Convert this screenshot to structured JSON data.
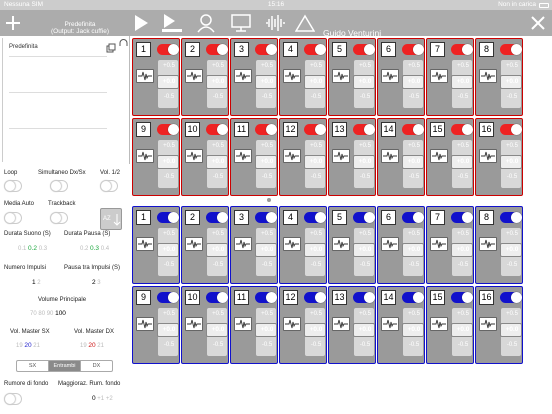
{
  "status": {
    "carrier": "Nessuna SIM",
    "time": "15:16",
    "battery": "Non in carica"
  },
  "toolbar": {
    "preset_title": "Predefinita",
    "output": "(Output: Jack cuffie)",
    "user": "Guido Venturini"
  },
  "left": {
    "preset_name": "Predefinita",
    "loop": "Loop",
    "simultaneo": "Simultaneo Dx/Sx",
    "vol_half": "Vol. 1/2",
    "media_auto": "Media Auto",
    "trackback": "Trackback",
    "az": "AZ",
    "durata_suono": "Durata Suono (S)",
    "durata_pausa": "Durata Pausa (S)",
    "ds_vals": [
      "0.1",
      "0.2",
      "0.3"
    ],
    "dp_vals": [
      "0.2",
      "0.3",
      "0.4"
    ],
    "numero_impulsi": "Numero Impulsi",
    "pausa_impulsi": "Pausa tra Impulsi (S)",
    "ni_vals": [
      "1",
      "2"
    ],
    "pi_vals": [
      "2",
      "3"
    ],
    "volume_principale": "Volume Principale",
    "vp_vals": [
      "70",
      "80",
      "90",
      "100"
    ],
    "vol_master_sx": "Vol. Master SX",
    "vol_master_dx": "Vol. Master DX",
    "sx_vals": [
      "19",
      "20",
      "21"
    ],
    "dx_vals": [
      "19",
      "20",
      "21"
    ],
    "seg": [
      "SX",
      "Entrambi",
      "DX"
    ],
    "rumore": "Rumore di fondo",
    "maggioraz": "Maggioraz. Rum. fondo",
    "rum_vals": [
      "0",
      "+1",
      "+2"
    ]
  },
  "cells": {
    "plus": "+0.5",
    "zero": "+0.0",
    "minus": "-0.5",
    "red": [
      "1",
      "2",
      "3",
      "4",
      "5",
      "6",
      "7",
      "8",
      "9",
      "10",
      "11",
      "12",
      "13",
      "14",
      "15",
      "16"
    ],
    "blue": [
      "1",
      "2",
      "3",
      "4",
      "5",
      "6",
      "7",
      "8",
      "9",
      "10",
      "11",
      "12",
      "13",
      "14",
      "15",
      "16"
    ]
  },
  "colors": {
    "red_border": "#cc0000",
    "blue_border": "#1111cc",
    "toolbar": "#acacac"
  }
}
